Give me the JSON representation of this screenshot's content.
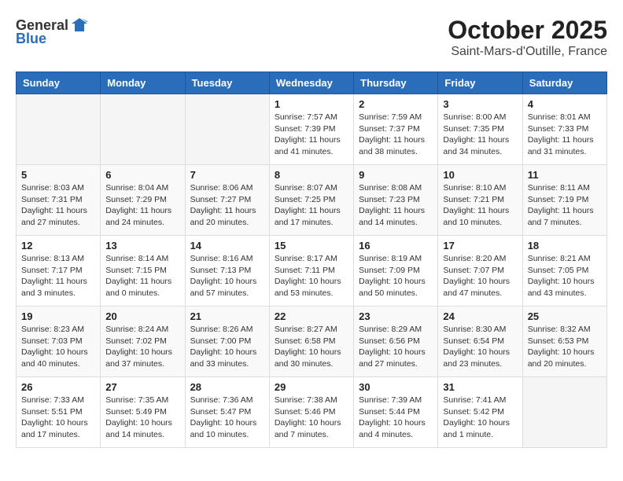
{
  "logo": {
    "general": "General",
    "blue": "Blue"
  },
  "header": {
    "month": "October 2025",
    "location": "Saint-Mars-d'Outille, France"
  },
  "weekdays": [
    "Sunday",
    "Monday",
    "Tuesday",
    "Wednesday",
    "Thursday",
    "Friday",
    "Saturday"
  ],
  "weeks": [
    [
      {
        "day": "",
        "info": ""
      },
      {
        "day": "",
        "info": ""
      },
      {
        "day": "",
        "info": ""
      },
      {
        "day": "1",
        "info": "Sunrise: 7:57 AM\nSunset: 7:39 PM\nDaylight: 11 hours and 41 minutes."
      },
      {
        "day": "2",
        "info": "Sunrise: 7:59 AM\nSunset: 7:37 PM\nDaylight: 11 hours and 38 minutes."
      },
      {
        "day": "3",
        "info": "Sunrise: 8:00 AM\nSunset: 7:35 PM\nDaylight: 11 hours and 34 minutes."
      },
      {
        "day": "4",
        "info": "Sunrise: 8:01 AM\nSunset: 7:33 PM\nDaylight: 11 hours and 31 minutes."
      }
    ],
    [
      {
        "day": "5",
        "info": "Sunrise: 8:03 AM\nSunset: 7:31 PM\nDaylight: 11 hours and 27 minutes."
      },
      {
        "day": "6",
        "info": "Sunrise: 8:04 AM\nSunset: 7:29 PM\nDaylight: 11 hours and 24 minutes."
      },
      {
        "day": "7",
        "info": "Sunrise: 8:06 AM\nSunset: 7:27 PM\nDaylight: 11 hours and 20 minutes."
      },
      {
        "day": "8",
        "info": "Sunrise: 8:07 AM\nSunset: 7:25 PM\nDaylight: 11 hours and 17 minutes."
      },
      {
        "day": "9",
        "info": "Sunrise: 8:08 AM\nSunset: 7:23 PM\nDaylight: 11 hours and 14 minutes."
      },
      {
        "day": "10",
        "info": "Sunrise: 8:10 AM\nSunset: 7:21 PM\nDaylight: 11 hours and 10 minutes."
      },
      {
        "day": "11",
        "info": "Sunrise: 8:11 AM\nSunset: 7:19 PM\nDaylight: 11 hours and 7 minutes."
      }
    ],
    [
      {
        "day": "12",
        "info": "Sunrise: 8:13 AM\nSunset: 7:17 PM\nDaylight: 11 hours and 3 minutes."
      },
      {
        "day": "13",
        "info": "Sunrise: 8:14 AM\nSunset: 7:15 PM\nDaylight: 11 hours and 0 minutes."
      },
      {
        "day": "14",
        "info": "Sunrise: 8:16 AM\nSunset: 7:13 PM\nDaylight: 10 hours and 57 minutes."
      },
      {
        "day": "15",
        "info": "Sunrise: 8:17 AM\nSunset: 7:11 PM\nDaylight: 10 hours and 53 minutes."
      },
      {
        "day": "16",
        "info": "Sunrise: 8:19 AM\nSunset: 7:09 PM\nDaylight: 10 hours and 50 minutes."
      },
      {
        "day": "17",
        "info": "Sunrise: 8:20 AM\nSunset: 7:07 PM\nDaylight: 10 hours and 47 minutes."
      },
      {
        "day": "18",
        "info": "Sunrise: 8:21 AM\nSunset: 7:05 PM\nDaylight: 10 hours and 43 minutes."
      }
    ],
    [
      {
        "day": "19",
        "info": "Sunrise: 8:23 AM\nSunset: 7:03 PM\nDaylight: 10 hours and 40 minutes."
      },
      {
        "day": "20",
        "info": "Sunrise: 8:24 AM\nSunset: 7:02 PM\nDaylight: 10 hours and 37 minutes."
      },
      {
        "day": "21",
        "info": "Sunrise: 8:26 AM\nSunset: 7:00 PM\nDaylight: 10 hours and 33 minutes."
      },
      {
        "day": "22",
        "info": "Sunrise: 8:27 AM\nSunset: 6:58 PM\nDaylight: 10 hours and 30 minutes."
      },
      {
        "day": "23",
        "info": "Sunrise: 8:29 AM\nSunset: 6:56 PM\nDaylight: 10 hours and 27 minutes."
      },
      {
        "day": "24",
        "info": "Sunrise: 8:30 AM\nSunset: 6:54 PM\nDaylight: 10 hours and 23 minutes."
      },
      {
        "day": "25",
        "info": "Sunrise: 8:32 AM\nSunset: 6:53 PM\nDaylight: 10 hours and 20 minutes."
      }
    ],
    [
      {
        "day": "26",
        "info": "Sunrise: 7:33 AM\nSunset: 5:51 PM\nDaylight: 10 hours and 17 minutes."
      },
      {
        "day": "27",
        "info": "Sunrise: 7:35 AM\nSunset: 5:49 PM\nDaylight: 10 hours and 14 minutes."
      },
      {
        "day": "28",
        "info": "Sunrise: 7:36 AM\nSunset: 5:47 PM\nDaylight: 10 hours and 10 minutes."
      },
      {
        "day": "29",
        "info": "Sunrise: 7:38 AM\nSunset: 5:46 PM\nDaylight: 10 hours and 7 minutes."
      },
      {
        "day": "30",
        "info": "Sunrise: 7:39 AM\nSunset: 5:44 PM\nDaylight: 10 hours and 4 minutes."
      },
      {
        "day": "31",
        "info": "Sunrise: 7:41 AM\nSunset: 5:42 PM\nDaylight: 10 hours and 1 minute."
      },
      {
        "day": "",
        "info": ""
      }
    ]
  ]
}
